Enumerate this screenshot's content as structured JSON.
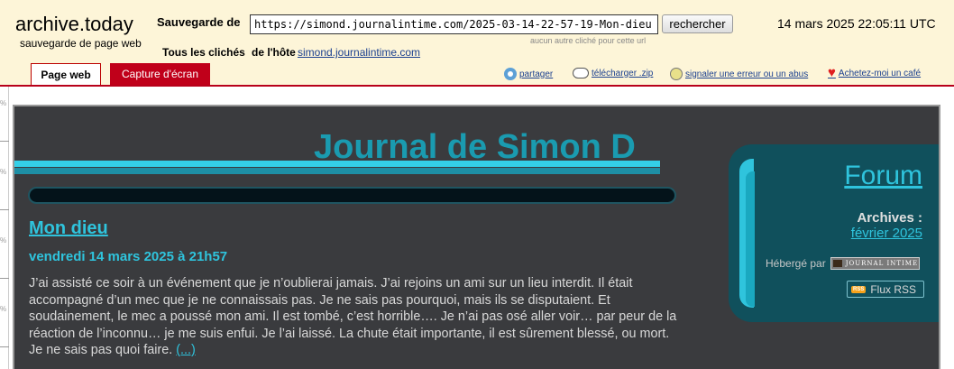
{
  "header": {
    "logo": "archive.today",
    "logo_sub": "sauvegarde de page web",
    "save_label": "Sauvegarde de",
    "url_value": "https://simond.journalintime.com/2025-03-14-22-57-19-Mon-dieu",
    "search_button": "rechercher",
    "no_other_snapshot": "aucun autre cliché pour cette url",
    "date": "14 mars 2025 22:05:11 UTC",
    "all_snapshots": "Tous les clichés",
    "host_label": "de l'hôte",
    "host_link": "simond.journalintime.com"
  },
  "tabs": [
    {
      "label": "Page web",
      "active": true
    },
    {
      "label": "Capture d'écran",
      "active": false
    }
  ],
  "actions": {
    "share": "partager",
    "download": "télécharger .zip",
    "report": "signaler une erreur ou un abus",
    "coffee": "Achetez-moi un café"
  },
  "ruler": {
    "labels": [
      "%",
      "%",
      "%",
      "%",
      "%"
    ]
  },
  "page": {
    "site_title": "Journal de Simon D",
    "post_title": "Mon dieu",
    "post_date": "vendredi 14 mars 2025 à 21h57",
    "post_text": "J’ai assisté ce soir à un événement que je n’oublierai jamais. J’ai rejoins un ami sur un lieu interdit. Il était accompagné d’un mec que je ne connaissais pas. Je ne sais pas pourquoi, mais ils se disputaient. Et soudainement, le mec a poussé mon ami. Il est tombé, c’est horrible…. Je n’ai pas osé aller voir… par peur de la réaction de l’inconnu… je me suis enfui. Je l’ai laissé. La chute était importante, il est sûrement blessé, ou mort. Je ne sais pas quoi faire.",
    "more_link": "(...)"
  },
  "sidebar": {
    "forum": "Forum",
    "archives_label": "Archives :",
    "archive_month": "février 2025",
    "hosted_by": "Hébergé par",
    "hosted_badge": "JOURNAL INTIME",
    "rss_badge": "RSS",
    "rss_label": "Flux RSS"
  },
  "colors": {
    "header_bg": "#fdf5d8",
    "tab_red": "#c0001a",
    "page_bg": "#3a3b3e",
    "accent": "#2fc4dd",
    "sidebar_bg": "#10505c"
  },
  "icons": [
    "share-icon",
    "download-cloud-icon",
    "bulb-icon",
    "heart-icon",
    "rss-icon"
  ]
}
